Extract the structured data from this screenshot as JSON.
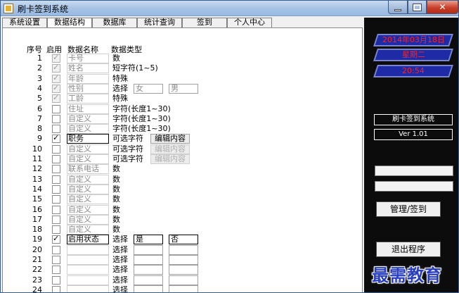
{
  "window": {
    "title": "刷卡签到系统"
  },
  "tabs": [
    {
      "label": "系统设置"
    },
    {
      "label": "数据结构"
    },
    {
      "label": "数据库"
    },
    {
      "label": "统计查询"
    },
    {
      "label": "签到"
    },
    {
      "label": "个人中心"
    }
  ],
  "headers": {
    "seq": "序号",
    "enabled": "启用",
    "field_name": "数据名称",
    "field_type": "数据类型"
  },
  "rows": [
    {
      "num": "1",
      "enabled": true,
      "locked": true,
      "name": "卡号",
      "type": "数"
    },
    {
      "num": "2",
      "enabled": true,
      "locked": true,
      "name": "姓名",
      "type": "短字符(1~5)"
    },
    {
      "num": "3",
      "enabled": true,
      "locked": true,
      "name": "年龄",
      "type": "特殊"
    },
    {
      "num": "4",
      "enabled": true,
      "locked": true,
      "name": "性别",
      "type": "选择",
      "opt1": "女",
      "opt2": "男"
    },
    {
      "num": "5",
      "enabled": true,
      "locked": true,
      "name": "工龄",
      "type": "特殊"
    },
    {
      "num": "6",
      "enabled": false,
      "locked": false,
      "name": "住址",
      "type": "字符(长度1~30)"
    },
    {
      "num": "7",
      "enabled": false,
      "locked": false,
      "name": "自定义",
      "type": "字符(长度1~30)"
    },
    {
      "num": "8",
      "enabled": false,
      "locked": false,
      "name": "自定义",
      "type": "字符(长度1~30)"
    },
    {
      "num": "9",
      "enabled": true,
      "locked": false,
      "name": "职务",
      "type": "可选字符",
      "edit": "编辑内容",
      "edit_enabled": true
    },
    {
      "num": "10",
      "enabled": false,
      "locked": false,
      "name": "自定义",
      "type": "可选字符",
      "edit": "编辑内容",
      "edit_enabled": false
    },
    {
      "num": "11",
      "enabled": false,
      "locked": false,
      "name": "自定义",
      "type": "可选字符",
      "edit": "编辑内容",
      "edit_enabled": false
    },
    {
      "num": "12",
      "enabled": false,
      "locked": false,
      "name": "联系电话",
      "type": "数"
    },
    {
      "num": "13",
      "enabled": false,
      "locked": false,
      "name": "自定义",
      "type": "数"
    },
    {
      "num": "14",
      "enabled": false,
      "locked": false,
      "name": "自定义",
      "type": "数"
    },
    {
      "num": "15",
      "enabled": false,
      "locked": false,
      "name": "自定义",
      "type": "数"
    },
    {
      "num": "16",
      "enabled": false,
      "locked": false,
      "name": "自定义",
      "type": "数"
    },
    {
      "num": "17",
      "enabled": false,
      "locked": false,
      "name": "自定义",
      "type": "数"
    },
    {
      "num": "18",
      "enabled": false,
      "locked": false,
      "name": "自定义",
      "type": "数"
    },
    {
      "num": "19",
      "enabled": true,
      "locked": false,
      "name": "启用状态",
      "type": "选择",
      "opt1": "是",
      "opt2": "否"
    },
    {
      "num": "20",
      "enabled": false,
      "locked": false,
      "name": "",
      "type": "选择",
      "opt1": "",
      "opt2": ""
    },
    {
      "num": "21",
      "enabled": false,
      "locked": false,
      "name": "",
      "type": "选择",
      "opt1": "",
      "opt2": ""
    },
    {
      "num": "22",
      "enabled": false,
      "locked": false,
      "name": "",
      "type": "选择",
      "opt1": "",
      "opt2": ""
    },
    {
      "num": "23",
      "enabled": false,
      "locked": false,
      "name": "",
      "type": "选择",
      "opt1": "",
      "opt2": ""
    },
    {
      "num": "24",
      "enabled": false,
      "locked": false,
      "name": "",
      "type": "选择",
      "opt1": "",
      "opt2": ""
    }
  ],
  "sidebar": {
    "date": "2014年03月18日",
    "weekday": "星期二",
    "time": "20:54",
    "app_name": "刷卡签到系统",
    "version": "Ver 1.01",
    "manage_button": "管理/签到",
    "exit_button": "退出程序"
  },
  "watermark": "最需教育"
}
